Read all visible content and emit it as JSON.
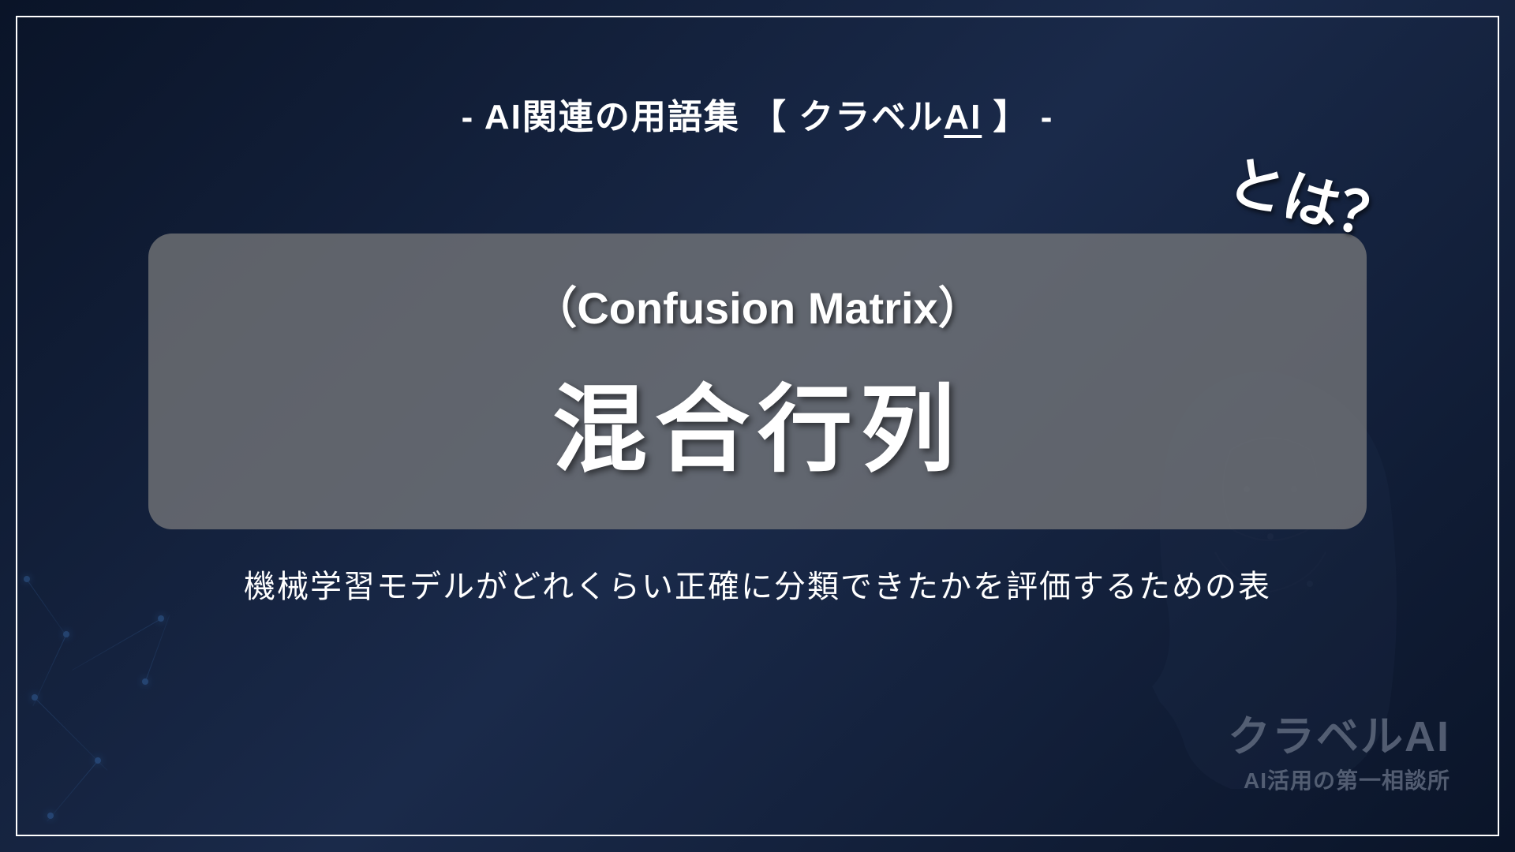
{
  "header": {
    "title_prefix": "- AI関連の用語集 【 クラベル",
    "title_ai": "AI",
    "title_suffix": " 】 -"
  },
  "main": {
    "english_label": "（Confusion Matrix）",
    "japanese_title": "混合行列",
    "toha_badge": "とは？",
    "description": "機械学習モデルがどれくらい正確に分類できたかを評価するための表"
  },
  "brand": {
    "name": "クラベルAI",
    "tagline": "AI活用の第一相談所"
  }
}
